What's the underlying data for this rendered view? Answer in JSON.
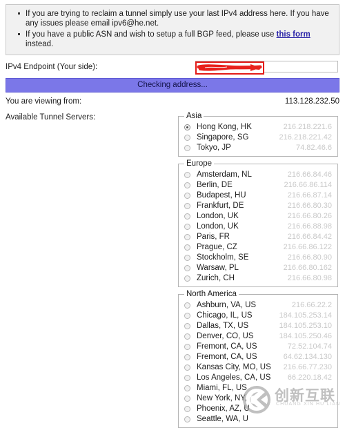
{
  "notice": {
    "items": [
      {
        "text_before": "If you are trying to reclaim a tunnel simply use your last IPv4 address here. If you have any issues please email ipv6@he.net.",
        "link": "",
        "text_after": ""
      },
      {
        "text_before": "If you have a public ASN and wish to setup a full BGP feed, please use ",
        "link": "this form",
        "text_after": " instead."
      }
    ]
  },
  "endpoint": {
    "label": "IPv4 Endpoint (Your side):",
    "value": "",
    "placeholder": "",
    "redaction_color": "#e41b17"
  },
  "status": {
    "text": "Checking address...",
    "color": "#7b77e8"
  },
  "viewing_from": {
    "label": "You are viewing from:",
    "value": "113.128.232.50"
  },
  "servers": {
    "label": "Available Tunnel Servers:",
    "regions": [
      {
        "name": "Asia",
        "items": [
          {
            "name": "Hong Kong, HK",
            "ip": "216.218.221.6",
            "selected": true
          },
          {
            "name": "Singapore, SG",
            "ip": "216.218.221.42",
            "selected": false
          },
          {
            "name": "Tokyo, JP",
            "ip": "74.82.46.6",
            "selected": false
          }
        ]
      },
      {
        "name": "Europe",
        "items": [
          {
            "name": "Amsterdam, NL",
            "ip": "216.66.84.46",
            "selected": false
          },
          {
            "name": "Berlin, DE",
            "ip": "216.66.86.114",
            "selected": false
          },
          {
            "name": "Budapest, HU",
            "ip": "216.66.87.14",
            "selected": false
          },
          {
            "name": "Frankfurt, DE",
            "ip": "216.66.80.30",
            "selected": false
          },
          {
            "name": "London, UK",
            "ip": "216.66.80.26",
            "selected": false
          },
          {
            "name": "London, UK",
            "ip": "216.66.88.98",
            "selected": false
          },
          {
            "name": "Paris, FR",
            "ip": "216.66.84.42",
            "selected": false
          },
          {
            "name": "Prague, CZ",
            "ip": "216.66.86.122",
            "selected": false
          },
          {
            "name": "Stockholm, SE",
            "ip": "216.66.80.90",
            "selected": false
          },
          {
            "name": "Warsaw, PL",
            "ip": "216.66.80.162",
            "selected": false
          },
          {
            "name": "Zurich, CH",
            "ip": "216.66.80.98",
            "selected": false
          }
        ]
      },
      {
        "name": "North America",
        "items": [
          {
            "name": "Ashburn, VA, US",
            "ip": "216.66.22.2",
            "selected": false
          },
          {
            "name": "Chicago, IL, US",
            "ip": "184.105.253.14",
            "selected": false
          },
          {
            "name": "Dallas, TX, US",
            "ip": "184.105.253.10",
            "selected": false
          },
          {
            "name": "Denver, CO, US",
            "ip": "184.105.250.46",
            "selected": false
          },
          {
            "name": "Fremont, CA, US",
            "ip": "72.52.104.74",
            "selected": false
          },
          {
            "name": "Fremont, CA, US",
            "ip": "64.62.134.130",
            "selected": false
          },
          {
            "name": "Kansas City, MO, US",
            "ip": "216.66.77.230",
            "selected": false
          },
          {
            "name": "Los Angeles, CA, US",
            "ip": "66.220.18.42",
            "selected": false
          },
          {
            "name": "Miami, FL, US",
            "ip": "",
            "selected": false
          },
          {
            "name": "New York, NY,",
            "ip": "",
            "selected": false
          },
          {
            "name": "Phoenix, AZ, U",
            "ip": "",
            "selected": false
          },
          {
            "name": "Seattle, WA, U",
            "ip": "",
            "selected": false
          }
        ]
      }
    ]
  },
  "watermark": {
    "chinese": "创新互联",
    "pinyin": "CHUANG XIN HU LIAN",
    "logo_text": "CX"
  }
}
